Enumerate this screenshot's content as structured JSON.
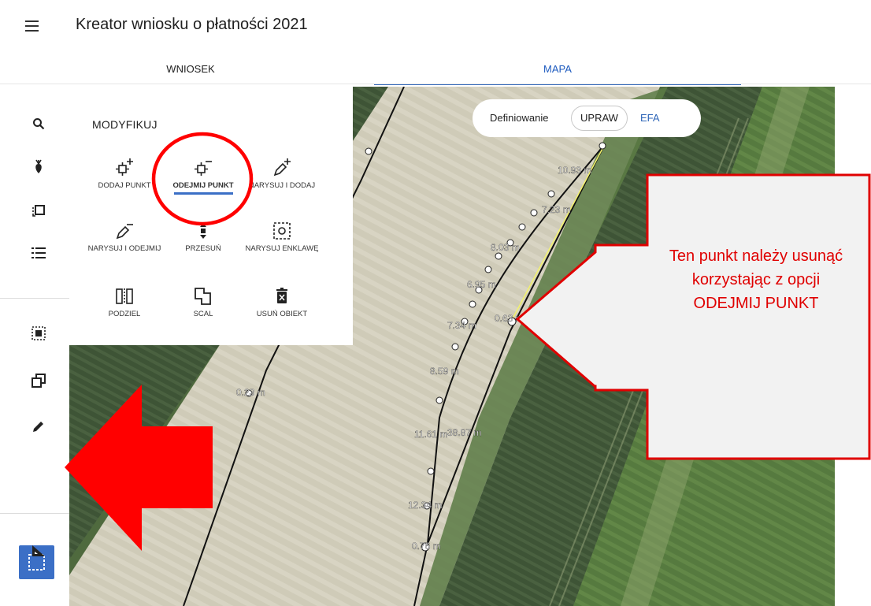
{
  "header": {
    "title": "Kreator wniosku o płatności 2021",
    "menu_icon": "hamburger-menu-icon"
  },
  "tabs": [
    {
      "label": "WNIOSEK",
      "active": false
    },
    {
      "label": "MAPA",
      "active": true
    }
  ],
  "toolbar": {
    "icons": [
      "search-icon",
      "crop-icon",
      "layers-icon",
      "list-icon",
      "select-icon",
      "copy-icon",
      "pencil-icon",
      "edit-selection-icon",
      "ruler-icon"
    ],
    "active": "edit-selection-icon"
  },
  "modify_panel": {
    "title": "MODYFIKUJ",
    "buttons": [
      {
        "label": "DODAJ PUNKT",
        "icon": "add-point-icon"
      },
      {
        "label": "ODEJMIJ PUNKT",
        "icon": "remove-point-icon",
        "active": true
      },
      {
        "label": "NARYSUJ I DODAJ",
        "icon": "draw-add-icon"
      },
      {
        "label": "NARYSUJ I ODEJMIJ",
        "icon": "draw-subtract-icon"
      },
      {
        "label": "PRZESUŃ",
        "icon": "move-icon"
      },
      {
        "label": "NARYSUJ ENKLAWĘ",
        "icon": "enclave-icon"
      },
      {
        "label": "PODZIEL",
        "icon": "split-icon"
      },
      {
        "label": "SCAL",
        "icon": "merge-icon"
      },
      {
        "label": "USUŃ OBIEKT",
        "icon": "delete-icon"
      }
    ]
  },
  "mode_toggle": {
    "label": "Definiowanie",
    "options": [
      "UPRAW",
      "EFA"
    ],
    "selected": "UPRAW"
  },
  "map_labels": [
    "10.93 m",
    "7.23 m",
    "8.03 m",
    "6.95 m",
    "7.34 m",
    "0.63 m",
    "8.59 m",
    "0.23 m",
    "11.61 m",
    "38.87 m",
    "12.34 m",
    "0.76 m"
  ],
  "callout": {
    "text": "Ten punkt należy usunąć korzystając z opcji ODEJMIJ PUNKT"
  },
  "colors": {
    "accent": "#2f66b8",
    "annotation_red": "#ff0000",
    "active_tool_bg": "#3b6fc6"
  }
}
